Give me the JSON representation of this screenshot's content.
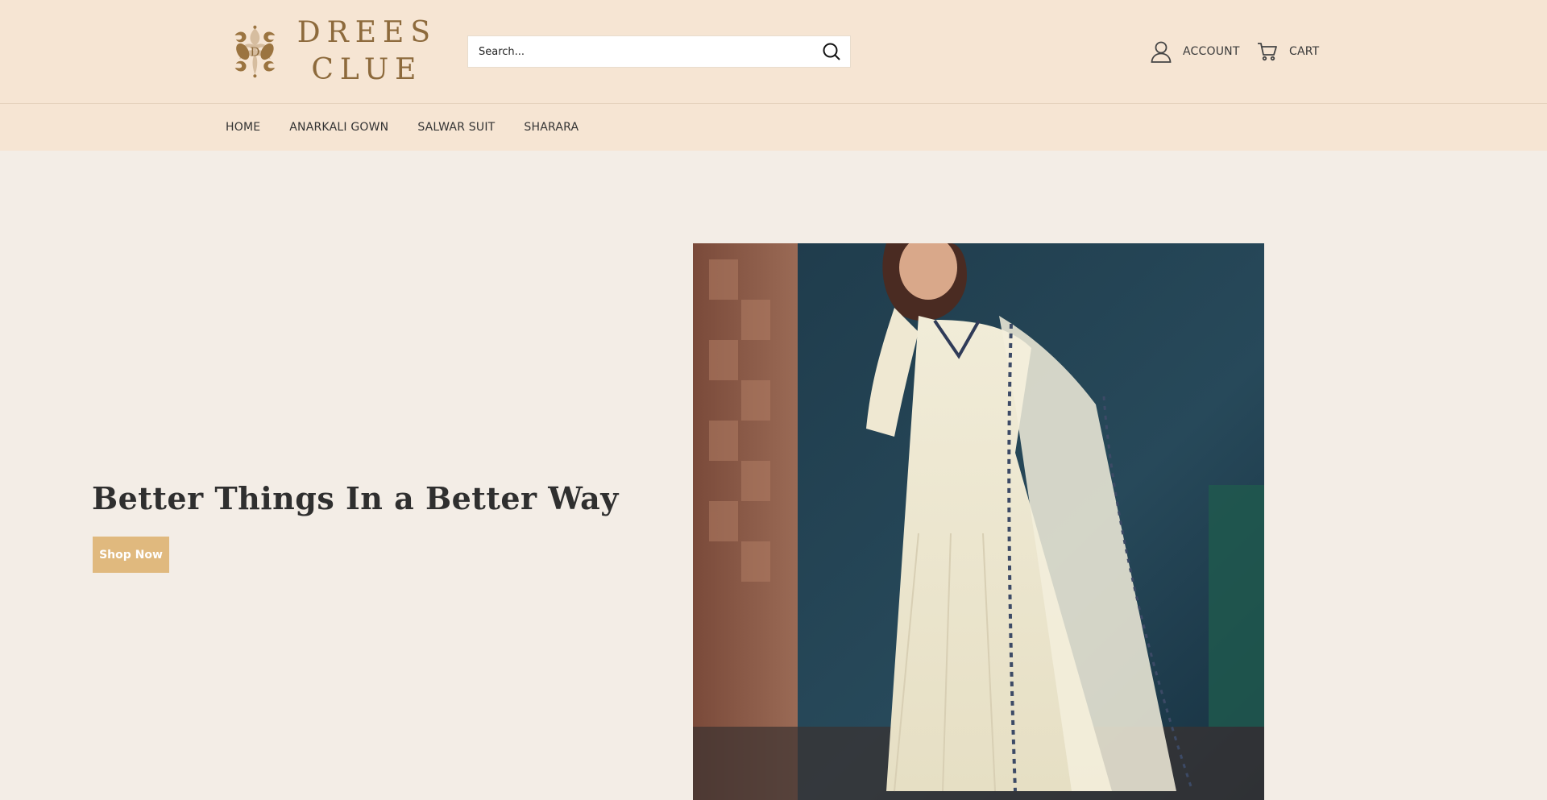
{
  "brand": {
    "name_line1": "DREES",
    "name_line2": "CLUE",
    "monogram": "D"
  },
  "search": {
    "placeholder": "Search..."
  },
  "header_links": {
    "account_label": "ACCOUNT",
    "cart_label": "CART"
  },
  "nav": {
    "items": [
      "HOME",
      "ANARKALI GOWN",
      "SALWAR SUIT",
      "SHARARA"
    ]
  },
  "hero": {
    "title": "Better Things In a Better Way",
    "button_label": "Shop Now"
  },
  "colors": {
    "header_bg": "#f6e5d3",
    "page_bg": "#f3ede6",
    "accent": "#e0b97e",
    "logo": "#8d6a3c"
  },
  "icons": {
    "search": "search-icon",
    "account": "user-icon",
    "cart": "cart-icon"
  }
}
